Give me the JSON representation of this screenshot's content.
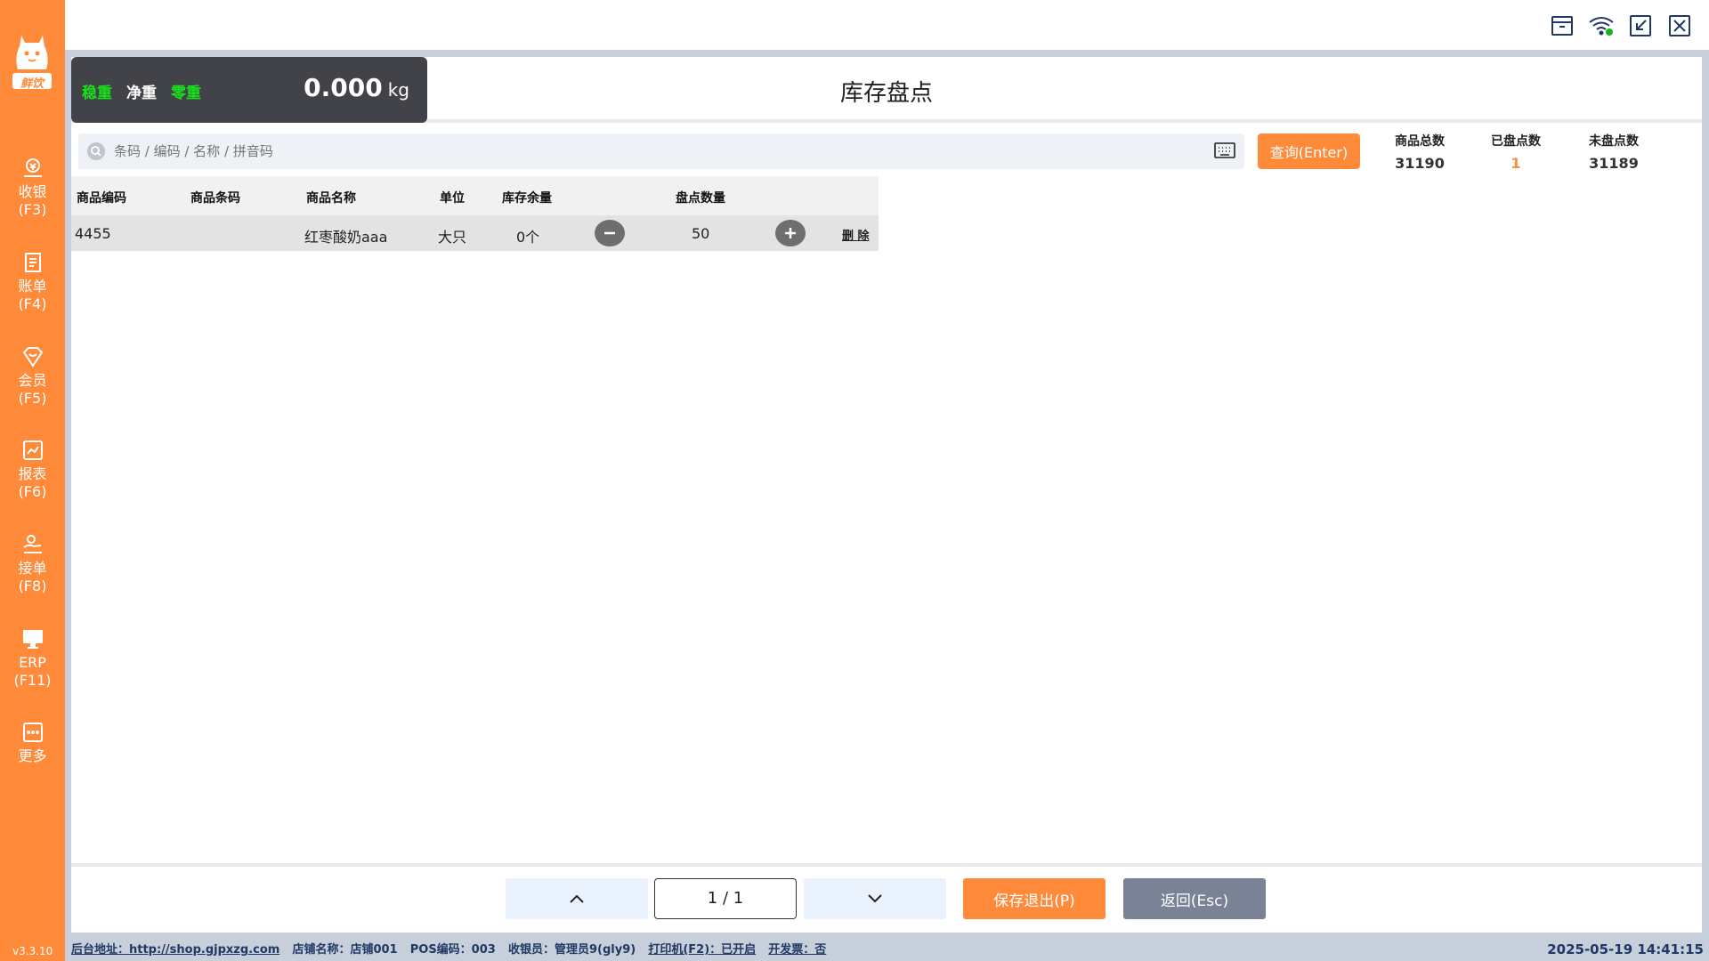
{
  "sidebar": {
    "brand": "鲜饮",
    "version": "v3.3.10",
    "items": [
      {
        "label": "收银",
        "key": "(F3)",
        "icon": "cashier-icon"
      },
      {
        "label": "账单",
        "key": "(F4)",
        "icon": "bill-icon"
      },
      {
        "label": "会员",
        "key": "(F5)",
        "icon": "member-icon"
      },
      {
        "label": "报表",
        "key": "(F6)",
        "icon": "report-icon"
      },
      {
        "label": "接单",
        "key": "(F8)",
        "icon": "order-icon"
      },
      {
        "label": "ERP",
        "key": "(F11)",
        "icon": "erp-icon"
      },
      {
        "label": "更多",
        "key": "",
        "icon": "more-icon"
      }
    ]
  },
  "scale": {
    "stable": "稳重",
    "net": "净重",
    "zero": "零重",
    "weight": "0.000",
    "unit": "kg"
  },
  "page_title": "库存盘点",
  "search": {
    "placeholder": "条码 / 编码 / 名称 / 拼音码",
    "query_button": "查询(Enter)"
  },
  "stats": {
    "total_label": "商品总数",
    "total_value": "31190",
    "counted_label": "已盘点数",
    "counted_value": "1",
    "uncounted_label": "未盘点数",
    "uncounted_value": "31189"
  },
  "table": {
    "headers": {
      "code": "商品编码",
      "barcode": "商品条码",
      "name": "商品名称",
      "unit": "单位",
      "stock": "库存余量",
      "count": "盘点数量"
    },
    "rows": [
      {
        "code": "4455",
        "barcode": "",
        "name": "红枣酸奶aaa",
        "unit": "大只",
        "stock": "0个",
        "count": "50",
        "delete": "删 除"
      }
    ]
  },
  "pager": {
    "page": "1 / 1",
    "save": "保存退出(P)",
    "back": "返回(Esc)"
  },
  "status": {
    "backend": "后台地址：http://shop.gjpxzg.com",
    "store": "店铺名称：店铺001",
    "pos": "POS编码：003",
    "cashier": "收银员：管理员9(gly9)",
    "printer": "打印机(F2)：已开启",
    "invoice": "开发票：否",
    "datetime": "2025-05-19 14:41:15"
  },
  "colors": {
    "accent": "#ff8a3a",
    "scale_bg": "#424249",
    "scale_green": "#19e119",
    "back_button": "#7a8396"
  }
}
